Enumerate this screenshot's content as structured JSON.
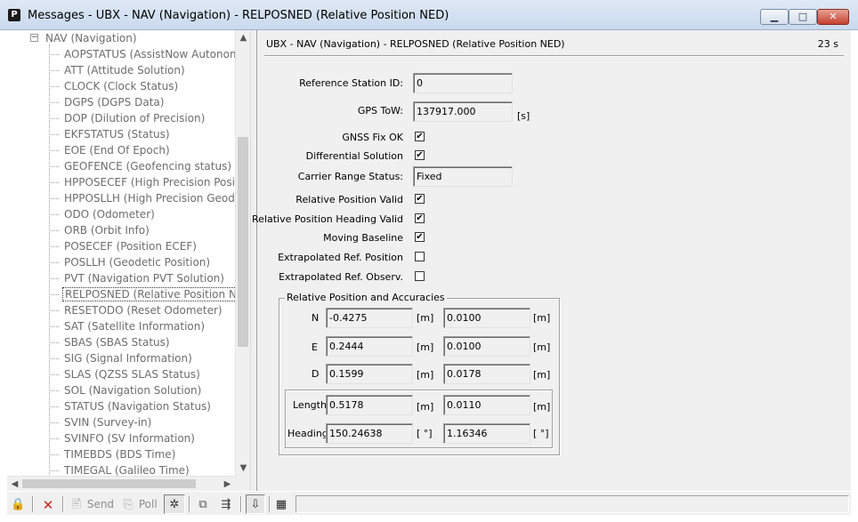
{
  "window": {
    "title": "Messages - UBX - NAV (Navigation) - RELPOSNED (Relative Position NED)",
    "app_icon": "P",
    "minimize_glyph": "▁",
    "maximize_glyph": "□",
    "close_glyph": "✕"
  },
  "tree": {
    "parent": {
      "expander": "−",
      "label": "NAV (Navigation)"
    },
    "items": [
      "AOPSTATUS (AssistNow Autonomou",
      "ATT (Attitude Solution)",
      "CLOCK (Clock Status)",
      "DGPS (DGPS Data)",
      "DOP (Dilution of Precision)",
      "EKFSTATUS (Status)",
      "EOE (End Of Epoch)",
      "GEOFENCE (Geofencing status)",
      "HPPOSECEF (High Precision Position",
      "HPPOSLLH (High Precision Geodetic",
      "ODO (Odometer)",
      "ORB (Orbit Info)",
      "POSECEF (Position ECEF)",
      "POSLLH (Geodetic Position)",
      "PVT (Navigation PVT Solution)",
      "RELPOSNED (Relative Position NED)",
      "RESETODO (Reset Odometer)",
      "SAT (Satellite Information)",
      "SBAS (SBAS Status)",
      "SIG (Signal Information)",
      "SLAS (QZSS SLAS Status)",
      "SOL (Navigation Solution)",
      "STATUS (Navigation Status)",
      "SVIN (Survey-in)",
      "SVINFO (SV Information)",
      "TIMEBDS (BDS Time)",
      "TIMEGAL (Galileo Time)"
    ],
    "selected": "RELPOSNED (Relative Position NED)"
  },
  "view": {
    "header": "UBX - NAV (Navigation) - RELPOSNED (Relative Position NED)",
    "age": "23 s",
    "fields": {
      "ref_station_label": "Reference Station ID:",
      "ref_station_value": "0",
      "gps_tow_label": "GPS ToW:",
      "gps_tow_value": "137917.000",
      "gps_tow_unit": "[s]",
      "carrier_range_label": "Carrier Range Status:",
      "carrier_range_value": "Fixed"
    },
    "checks": [
      {
        "label": "GNSS Fix OK",
        "checked": true
      },
      {
        "label": "Differential Solution",
        "checked": true
      },
      {
        "label": "Relative Position Valid",
        "checked": true
      },
      {
        "label": "Relative Position Heading Valid",
        "checked": true
      },
      {
        "label": "Moving Baseline",
        "checked": true
      },
      {
        "label": "Extrapolated Ref. Position",
        "checked": false
      },
      {
        "label": "Extrapolated Ref. Observ.",
        "checked": false
      }
    ],
    "accuracy_group": {
      "title": "Relative Position and Accuracies",
      "rows": [
        {
          "axis": "N",
          "value": "-0.4275",
          "unit": "[m]",
          "acc": "0.0100",
          "acc_unit": "[m]"
        },
        {
          "axis": "E",
          "value": "0.2444",
          "unit": "[m]",
          "acc": "0.0100",
          "acc_unit": "[m]"
        },
        {
          "axis": "D",
          "value": "0.1599",
          "unit": "[m]",
          "acc": "0.0178",
          "acc_unit": "[m]"
        }
      ],
      "length": {
        "label": "Length",
        "value": "0.5178",
        "unit": "[m]",
        "acc": "0.0110",
        "acc_unit": "[m]"
      },
      "heading": {
        "label": "Heading",
        "value": "150.24638",
        "unit": "[ °]",
        "acc": "1.16346",
        "acc_unit": "[ °]"
      }
    }
  },
  "toolbar": {
    "lock_icon": "🔒",
    "delete_icon": "✕",
    "send_label": "Send",
    "poll_label": "Poll",
    "colors": {
      "delete": "#d0231a",
      "lock": "#d9a400"
    }
  }
}
